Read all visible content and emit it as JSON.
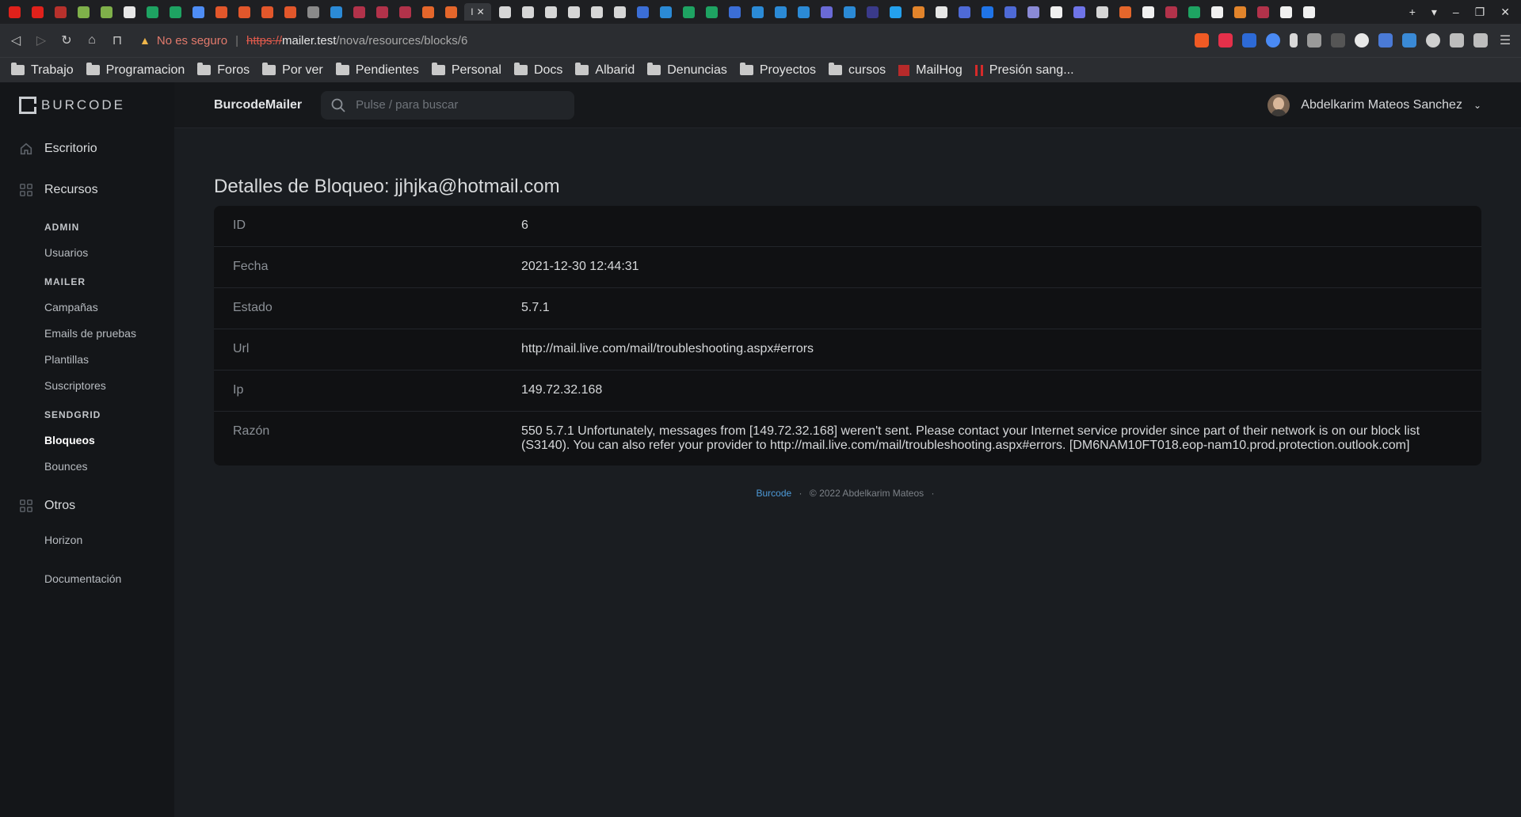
{
  "browser": {
    "tab_favicon_colors": [
      "#e0211b",
      "#e0211b",
      "#b7312c",
      "#7fb04a",
      "#7fb04a",
      "#e7e7e7",
      "#1ea362",
      "#1ea362",
      "#4e8df5",
      "#e2572b",
      "#e2572b",
      "#e2572b",
      "#e2572b",
      "#8a8a8a",
      "#2b8ad6",
      "#b2324a",
      "#b2324a",
      "#b2324a",
      "#e4662b",
      "#e4662b",
      "#d6d6d6",
      "#d6d6d6",
      "#d6d6d6",
      "#d6d6d6",
      "#d6d6d6",
      "#d6d6d6",
      "#3b6ed6",
      "#2b8ad6",
      "#1ea362",
      "#1ea362",
      "#3b6ed6",
      "#2b8ad6",
      "#2b8ad6",
      "#2b8ad6",
      "#6a6ad6",
      "#2b8ad6",
      "#3a3a8a",
      "#24a0ed",
      "#e2842b",
      "#e6e6e6",
      "#4e6ad6",
      "#1f74e8",
      "#4e6ad6",
      "#8a8ad6",
      "#f0f0f0",
      "#6f74e8",
      "#d6d6d6",
      "#e4662b",
      "#f0f0f0",
      "#b2324a",
      "#1ea362",
      "#f0f0f0",
      "#e2842b",
      "#b2324a",
      "#f0f0f0",
      "#f0f0f0"
    ],
    "active_tab_label": "I",
    "security_label": "No es seguro",
    "url_protocol": "https://",
    "url_host": "mailer.test",
    "url_path": "/nova/resources/blocks/6",
    "bookmarks": [
      {
        "label": "Trabajo",
        "type": "folder"
      },
      {
        "label": "Programacion",
        "type": "folder"
      },
      {
        "label": "Foros",
        "type": "folder"
      },
      {
        "label": "Por ver",
        "type": "folder"
      },
      {
        "label": "Pendientes",
        "type": "folder"
      },
      {
        "label": "Personal",
        "type": "folder"
      },
      {
        "label": "Docs",
        "type": "folder"
      },
      {
        "label": "Albarid",
        "type": "folder"
      },
      {
        "label": "Denuncias",
        "type": "folder"
      },
      {
        "label": "Proyectos",
        "type": "folder"
      },
      {
        "label": "cursos",
        "type": "folder"
      },
      {
        "label": "MailHog",
        "type": "link"
      },
      {
        "label": "Presión sang...",
        "type": "link"
      }
    ]
  },
  "sidebar": {
    "brand": "BURCODE",
    "escritorio": "Escritorio",
    "recursos": "Recursos",
    "groups": [
      {
        "heading": "ADMIN",
        "items": [
          "Usuarios"
        ]
      },
      {
        "heading": "MAILER",
        "items": [
          "Campañas",
          "Emails de pruebas",
          "Plantillas",
          "Suscriptores"
        ]
      },
      {
        "heading": "SENDGRID",
        "items": [
          "Bloqueos",
          "Bounces"
        ],
        "active": "Bloqueos"
      }
    ],
    "otros": "Otros",
    "otros_items": [
      "Horizon"
    ],
    "documentacion": "Documentación"
  },
  "header": {
    "app_name": "BurcodeMailer",
    "search_placeholder": "Pulse / para buscar",
    "user_name": "Abdelkarim Mateos Sanchez"
  },
  "detail": {
    "title": "Detalles de Bloqueo: jjhjka@hotmail.com",
    "fields": [
      {
        "label": "ID",
        "value": "6"
      },
      {
        "label": "Fecha",
        "value": "2021-12-30 12:44:31"
      },
      {
        "label": "Estado",
        "value": "5.7.1"
      },
      {
        "label": "Url",
        "value": "http://mail.live.com/mail/troubleshooting.aspx#errors"
      },
      {
        "label": "Ip",
        "value": "149.72.32.168"
      },
      {
        "label": "Razón",
        "value": "550 5.7.1 Unfortunately, messages from [149.72.32.168] weren't sent. Please contact your Internet service provider since part of their network is on our block list (S3140). You can also refer your provider to http://mail.live.com/mail/troubleshooting.aspx#errors. [DM6NAM10FT018.eop-nam10.prod.protection.outlook.com]"
      }
    ]
  },
  "footer": {
    "link": "Burcode",
    "text": "© 2022 Abdelkarim Mateos"
  }
}
